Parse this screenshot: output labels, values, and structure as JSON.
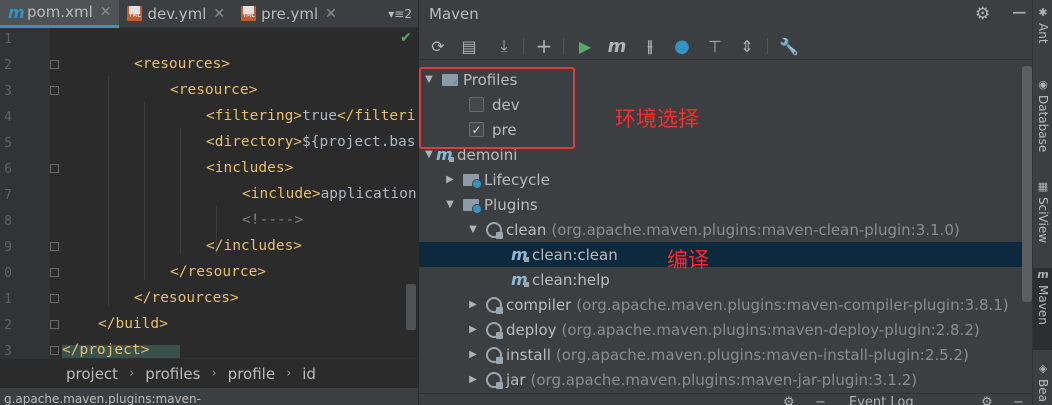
{
  "editor": {
    "tabs": [
      {
        "label": "pom.xml",
        "icon": "maven-file-icon",
        "active": true
      },
      {
        "label": "dev.yml",
        "icon": "yml-file-icon",
        "active": false
      },
      {
        "label": "pre.yml",
        "icon": "yml-file-icon",
        "active": false
      }
    ],
    "tab_overflow": "▾≡2",
    "line_numbers": [
      "1",
      "2",
      "3",
      "4",
      "5",
      "6",
      "7",
      "8",
      "9",
      "0",
      "1",
      "2",
      "3"
    ],
    "code": {
      "l2_open": "<resources>",
      "l3_open": "<resource>",
      "l4_open": "<filtering>",
      "l4_text": "true",
      "l4_close": "</filteri",
      "l5_open": "<directory>",
      "l5_text": "${project.bas",
      "l6_open": "<includes>",
      "l7_open": "<include>",
      "l7_text": "application",
      "l8_comment": "<!---->",
      "l9_close": "</includes>",
      "l10_close": "</resource>",
      "l11_close": "</resources>",
      "l12_close": "</build>",
      "l13_close": "</project>"
    },
    "breadcrumb": [
      "project",
      "profiles",
      "profile",
      "id"
    ],
    "status_text": "g.apache.maven.plugins:maven-"
  },
  "maven": {
    "title": "Maven",
    "profiles_label": "Profiles",
    "profiles": [
      {
        "name": "dev",
        "checked": false
      },
      {
        "name": "pre",
        "checked": true
      }
    ],
    "project": "demoini",
    "lifecycle_label": "Lifecycle",
    "plugins_label": "Plugins",
    "plugins": [
      {
        "name": "clean",
        "coord": "(org.apache.maven.plugins:maven-clean-plugin:3.1.0)",
        "expanded": true
      },
      {
        "name": "compiler",
        "coord": "(org.apache.maven.plugins:maven-compiler-plugin:3.8.1)",
        "expanded": false
      },
      {
        "name": "deploy",
        "coord": "(org.apache.maven.plugins:maven-deploy-plugin:2.8.2)",
        "expanded": false
      },
      {
        "name": "install",
        "coord": "(org.apache.maven.plugins:maven-install-plugin:2.5.2)",
        "expanded": false
      },
      {
        "name": "jar",
        "coord": "(org.apache.maven.plugins:maven-jar-plugin:3.1.2)",
        "expanded": false
      }
    ],
    "goals": [
      {
        "name": "clean:clean",
        "selected": true
      },
      {
        "name": "clean:help",
        "selected": false
      }
    ],
    "annotation_profile": "环境选择",
    "annotation_compile": "编译",
    "bottom_event_log": "Event Log"
  },
  "side_tabs": [
    {
      "label": "Ant",
      "icon": "ant-icon"
    },
    {
      "label": "Database",
      "icon": "database-icon"
    },
    {
      "label": "SciView",
      "icon": "sciview-icon"
    },
    {
      "label": "Maven",
      "icon": "maven-m-icon",
      "active": true
    },
    {
      "label": "Bea",
      "icon": "bean-icon"
    }
  ],
  "colors": {
    "accent": "#3592c4",
    "annotation_red": "#ff2a2a",
    "selection": "#0d293e",
    "xml_tag": "#e8bf6a"
  }
}
